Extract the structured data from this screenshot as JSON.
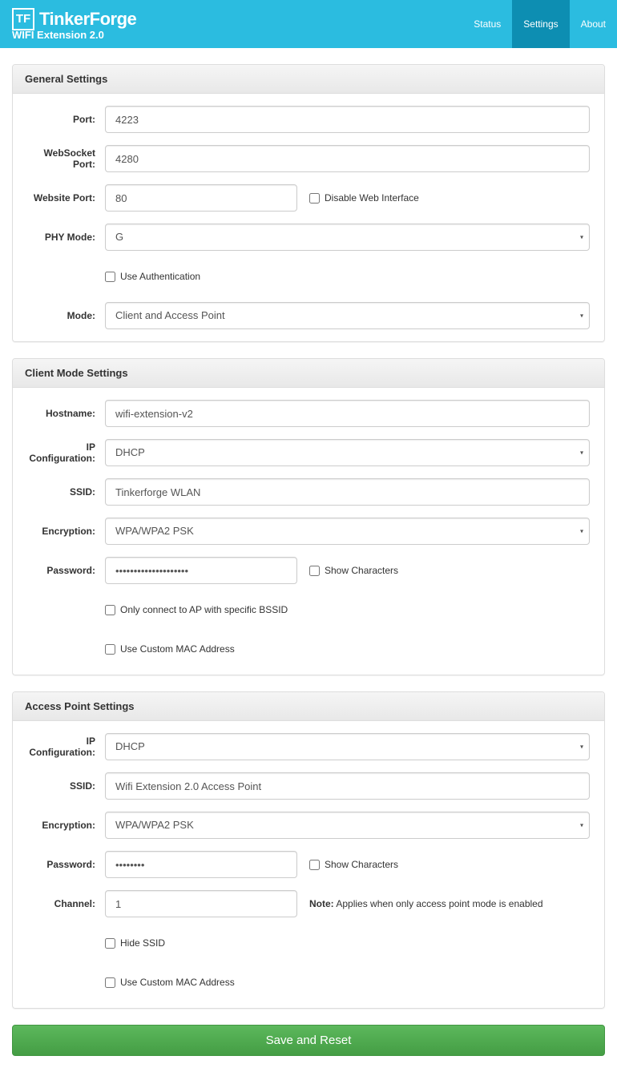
{
  "brand": {
    "name": "TinkerForge",
    "subtitle": "WIFI Extension 2.0",
    "logo_text": "TF"
  },
  "nav": {
    "status": "Status",
    "settings": "Settings",
    "about": "About"
  },
  "general": {
    "heading": "General Settings",
    "port_label": "Port:",
    "port_value": "4223",
    "websocket_port_label": "WebSocket Port:",
    "websocket_port_value": "4280",
    "website_port_label": "Website Port:",
    "website_port_value": "80",
    "disable_web_label": "Disable Web Interface",
    "phy_mode_label": "PHY Mode:",
    "phy_mode_value": "G",
    "use_auth_label": "Use Authentication",
    "mode_label": "Mode:",
    "mode_value": "Client and Access Point"
  },
  "client": {
    "heading": "Client Mode Settings",
    "hostname_label": "Hostname:",
    "hostname_value": "wifi-extension-v2",
    "ip_config_label": "IP Configuration:",
    "ip_config_value": "DHCP",
    "ssid_label": "SSID:",
    "ssid_value": "Tinkerforge WLAN",
    "encryption_label": "Encryption:",
    "encryption_value": "WPA/WPA2 PSK",
    "password_label": "Password:",
    "password_value": "••••••••••••••••••••",
    "show_chars_label": "Show Characters",
    "only_connect_label": "Only connect to AP with specific BSSID",
    "use_custom_mac_label": "Use Custom MAC Address"
  },
  "ap": {
    "heading": "Access Point Settings",
    "ip_config_label": "IP Configuration:",
    "ip_config_value": "DHCP",
    "ssid_label": "SSID:",
    "ssid_value": "Wifi Extension 2.0 Access Point",
    "encryption_label": "Encryption:",
    "encryption_value": "WPA/WPA2 PSK",
    "password_label": "Password:",
    "password_value": "••••••••",
    "show_chars_label": "Show Characters",
    "channel_label": "Channel:",
    "channel_value": "1",
    "channel_note_bold": "Note:",
    "channel_note": " Applies when only access point mode is enabled",
    "hide_ssid_label": "Hide SSID",
    "use_custom_mac_label": "Use Custom MAC Address"
  },
  "actions": {
    "save_reset": "Save and Reset"
  }
}
